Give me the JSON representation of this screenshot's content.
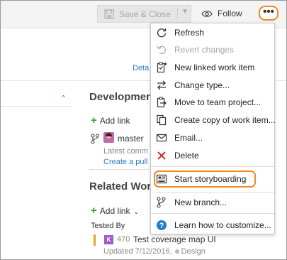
{
  "toolbar": {
    "save_label": "Save & Close",
    "follow_label": "Follow",
    "more_label": "•••"
  },
  "tabs": {
    "details_label": "Deta"
  },
  "development": {
    "title": "Developmer",
    "add_link_label": "Add link",
    "branch_name": "master",
    "latest_commit_text": "Latest comm",
    "create_pull_text": "Create a pull"
  },
  "related": {
    "title": "Related Wor",
    "add_link_label": "Add link",
    "tested_by_label": "Tested By",
    "work_item": {
      "type_letter": "K",
      "id": "470",
      "title": "Test coverage map UI",
      "updated_text": "Updated 7/12/2016,",
      "state": "Design"
    }
  },
  "menu": {
    "items": [
      {
        "label": "Refresh",
        "icon": "refresh-icon",
        "disabled": false
      },
      {
        "label": "Revert changes",
        "icon": "undo-icon",
        "disabled": true
      },
      {
        "label": "New linked work item",
        "icon": "clipboard-plus-icon",
        "disabled": false
      },
      {
        "label": "Change type...",
        "icon": "swap-arrows-icon",
        "disabled": false
      },
      {
        "label": "Move to team project...",
        "icon": "clipboard-move-icon",
        "disabled": false
      },
      {
        "label": "Create copy of work item...",
        "icon": "copy-icon",
        "disabled": false
      },
      {
        "label": "Email...",
        "icon": "mail-icon",
        "disabled": false
      },
      {
        "label": "Delete",
        "icon": "delete-x-icon",
        "disabled": false
      },
      {
        "label": "Start storyboarding",
        "icon": "storyboard-icon",
        "disabled": false
      },
      {
        "label": "New branch...",
        "icon": "branch-icon",
        "disabled": false
      },
      {
        "label": "Learn how to customize...",
        "icon": "help-icon",
        "disabled": false
      }
    ]
  },
  "colors": {
    "highlight": "#f08a24",
    "link": "#2b7bbf",
    "add_plus": "#2a9d3c",
    "delete_red": "#d22f27",
    "help_blue": "#1e7ad2"
  }
}
